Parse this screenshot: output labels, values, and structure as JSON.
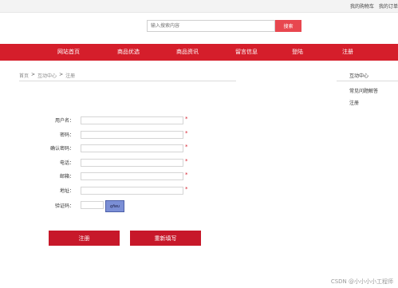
{
  "topbar": {
    "links": [
      "我的购物车",
      "我的订单"
    ]
  },
  "search": {
    "placeholder": "输入搜索内容",
    "button_label": "搜索"
  },
  "nav": {
    "items": [
      "网站首页",
      "商品优选",
      "商品资讯",
      "留言信息",
      "登陆",
      "注册"
    ]
  },
  "breadcrumb": {
    "items": [
      "首页",
      "互动中心",
      "注册"
    ],
    "separator": ">"
  },
  "sidebar": {
    "title": "互动中心",
    "links": [
      "常见问题解答",
      "注册"
    ]
  },
  "form": {
    "fields": [
      {
        "label": "用户名：",
        "required_mark": "*"
      },
      {
        "label": "密码：",
        "required_mark": "*"
      },
      {
        "label": "确认密码：",
        "required_mark": "*"
      },
      {
        "label": "电话：",
        "required_mark": "*"
      },
      {
        "label": "邮箱：",
        "required_mark": "*"
      },
      {
        "label": "地址：",
        "required_mark": "*"
      }
    ],
    "captcha_label": "验证码：",
    "captcha_code": "qfwu",
    "submit_label": "注册",
    "reset_label": "重新填写"
  },
  "watermark": "CSDN @小小小小工程师",
  "colors": {
    "nav_red": "#d51e2b",
    "button_red": "#c7182a",
    "search_red": "#e8474f"
  }
}
